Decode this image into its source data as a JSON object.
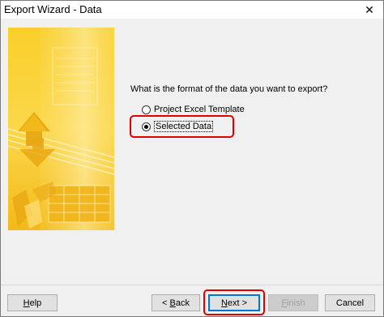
{
  "window": {
    "title": "Export Wizard - Data",
    "close_glyph": "✕"
  },
  "main": {
    "question": "What is the format of the data you want to export?",
    "options": [
      {
        "label": "Project Excel Template",
        "selected": false
      },
      {
        "label": "Selected Data",
        "selected": true
      }
    ]
  },
  "footer": {
    "help": {
      "key": "H",
      "rest": "elp"
    },
    "back": {
      "pre": "< ",
      "key": "B",
      "rest": "ack"
    },
    "next": {
      "key": "N",
      "rest": "ext >"
    },
    "finish": {
      "key": "F",
      "rest": "inish"
    },
    "cancel": "Cancel"
  },
  "annotation_color": "#e00000",
  "art_colors": {
    "base": "#f7c51c",
    "light": "#fde07a",
    "dark": "#e9a814",
    "pale": "#fff0b0"
  }
}
